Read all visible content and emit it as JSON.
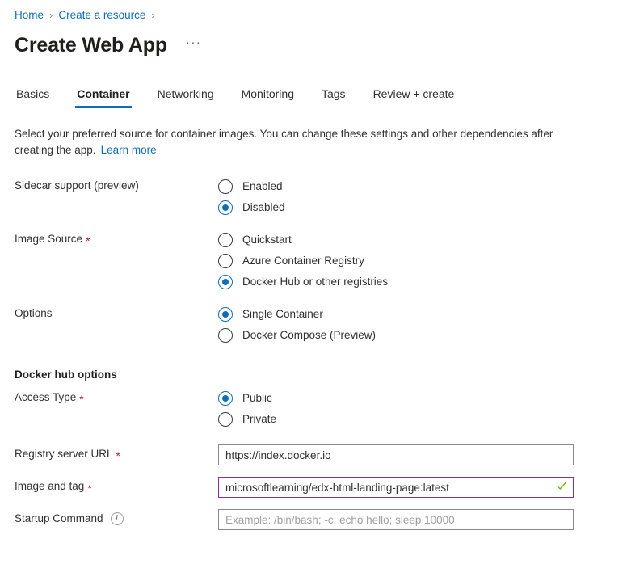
{
  "breadcrumb": {
    "items": [
      "Home",
      "Create a resource"
    ],
    "separator": "›"
  },
  "header": {
    "title": "Create Web App",
    "more_label": "···"
  },
  "tabs": [
    {
      "label": "Basics",
      "active": false
    },
    {
      "label": "Container",
      "active": true
    },
    {
      "label": "Networking",
      "active": false
    },
    {
      "label": "Monitoring",
      "active": false
    },
    {
      "label": "Tags",
      "active": false
    },
    {
      "label": "Review + create",
      "active": false
    }
  ],
  "description": {
    "text": "Select your preferred source for container images. You can change these settings and other dependencies after creating the app.",
    "link_label": "Learn more"
  },
  "form": {
    "sidecar": {
      "label": "Sidecar support (preview)",
      "options": [
        "Enabled",
        "Disabled"
      ],
      "selected": "Disabled"
    },
    "image_source": {
      "label": "Image Source",
      "required": "*",
      "options": [
        "Quickstart",
        "Azure Container Registry",
        "Docker Hub or other registries"
      ],
      "selected": "Docker Hub or other registries"
    },
    "options": {
      "label": "Options",
      "options": [
        "Single Container",
        "Docker Compose (Preview)"
      ],
      "selected": "Single Container"
    },
    "docker_hub_section": {
      "header": "Docker hub options",
      "access_type": {
        "label": "Access Type",
        "required": "*",
        "options": [
          "Public",
          "Private"
        ],
        "selected": "Public"
      },
      "registry_server_url": {
        "label": "Registry server URL",
        "required": "*",
        "value": "https://index.docker.io",
        "placeholder": ""
      },
      "image_and_tag": {
        "label": "Image and tag",
        "required": "*",
        "value": "microsoftlearning/edx-html-landing-page:latest",
        "placeholder": "",
        "validation": "valid",
        "valid_color": "#8c2f8c",
        "check_color": "#6bb700"
      },
      "startup_command": {
        "label": "Startup Command",
        "info": "ⓘ",
        "value": "",
        "placeholder": "Example: /bin/bash; -c; echo hello; sleep 10000"
      }
    }
  },
  "colors": {
    "accent": "#0f6cbd",
    "link": "#0f6cbd",
    "required": "#a4262c",
    "text": "#323130"
  }
}
